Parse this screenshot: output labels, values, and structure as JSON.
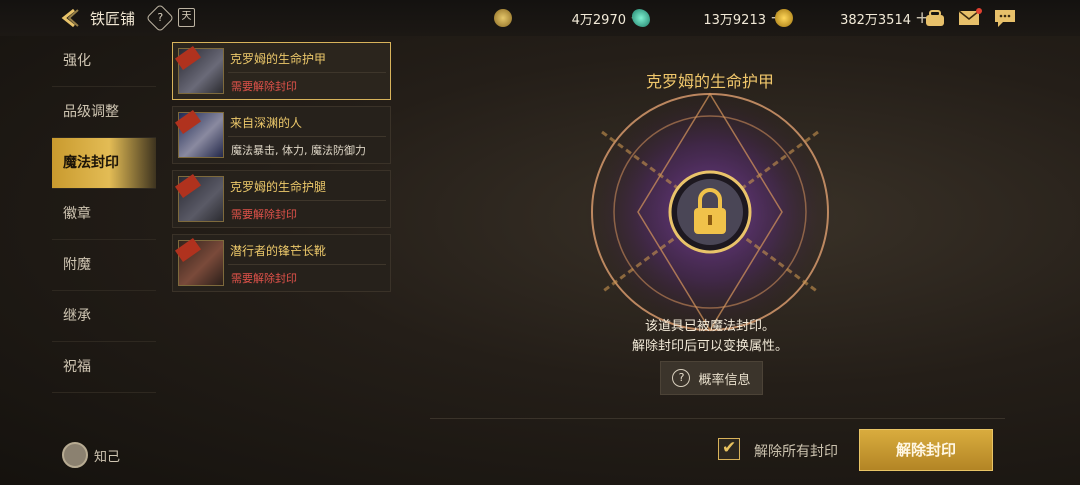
{
  "header": {
    "title": "铁匠铺",
    "help_glyph": "?",
    "calendar_glyph": "天",
    "currencies": [
      {
        "name": "gold-c-coin",
        "value": "4万2970",
        "color": "#c7a24a"
      },
      {
        "name": "gem",
        "value": "13万9213",
        "color": "#3fb9a0"
      },
      {
        "name": "gold-coin",
        "value": "382万3514",
        "color": "#e3b22c"
      }
    ],
    "plus_glyph": "+",
    "icons": [
      "bag-icon",
      "mail-icon",
      "chat-icon"
    ]
  },
  "sidebar": {
    "items": [
      {
        "label": "强化",
        "active": false
      },
      {
        "label": "品级调整",
        "active": false
      },
      {
        "label": "魔法封印",
        "active": true
      },
      {
        "label": "徽章",
        "active": false
      },
      {
        "label": "附魔",
        "active": false
      },
      {
        "label": "继承",
        "active": false
      },
      {
        "label": "祝福",
        "active": false
      }
    ],
    "footer_label": "知己"
  },
  "items": [
    {
      "name": "克罗姆的生命护甲",
      "sub": "需要解除封印",
      "sub_color": "red",
      "selected": true
    },
    {
      "name": "来自深渊的人",
      "sub": "魔法暴击, 体力, 魔法防御力",
      "sub_color": "white",
      "selected": false
    },
    {
      "name": "克罗姆的生命护腿",
      "sub": "需要解除封印",
      "sub_color": "red",
      "selected": false
    },
    {
      "name": "潜行者的锋芒长靴",
      "sub": "需要解除封印",
      "sub_color": "red",
      "selected": false
    }
  ],
  "detail": {
    "title": "克罗姆的生命护甲",
    "message_line1": "该道具已被魔法封印。",
    "message_line2": "解除封印后可以变换属性。",
    "prob_button": "概率信息",
    "release_all_label": "解除所有封印",
    "release_all_checked": true,
    "release_button": "解除封印"
  }
}
